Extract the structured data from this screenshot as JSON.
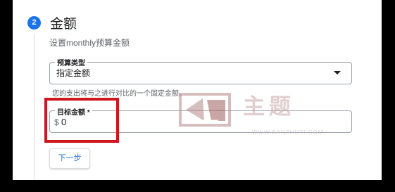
{
  "step": {
    "number": "2",
    "title": "金额",
    "description": "设置monthly预算金额"
  },
  "budget_type": {
    "label": "预算类型",
    "value": "指定金额",
    "hint": "您的支出将与之进行对比的一个固定金额。"
  },
  "target_amount": {
    "label": "目标金额 *",
    "currency_symbol": "$",
    "value": "0"
  },
  "actions": {
    "next_label": "下一步"
  },
  "watermark": {
    "text": "主题",
    "url": "WWW.BANZHUTI.COM"
  },
  "colors": {
    "accent": "#1a73e8",
    "highlight": "#d0151c"
  },
  "icons": {
    "dropdown": "caret-down-icon"
  }
}
